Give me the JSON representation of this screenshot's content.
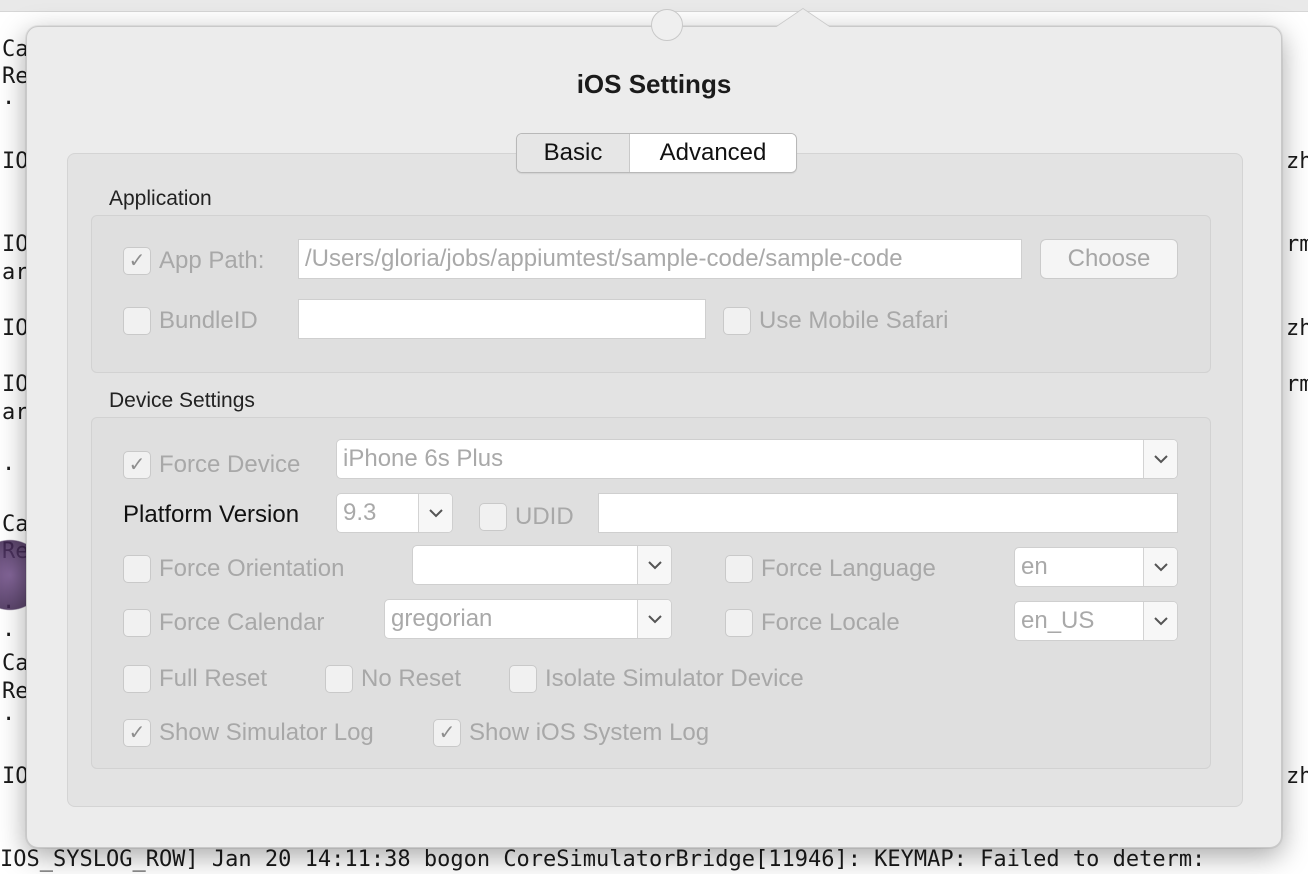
{
  "terminal": {
    "left_lines": [
      {
        "text": "Ca",
        "row": 50
      },
      {
        "text": "Re",
        "row": 77
      },
      {
        "text": "· G",
        "row": 104
      },
      {
        "text": "IO",
        "row": 162
      },
      {
        "text": "IO",
        "row": 245
      },
      {
        "text": "aro",
        "row": 273
      },
      {
        "text": "IO",
        "row": 329
      },
      {
        "text": "IO",
        "row": 385
      },
      {
        "text": "aro",
        "row": 413
      },
      {
        "text": "· G",
        "row": 470
      },
      {
        "text": "Ca",
        "row": 525
      },
      {
        "text": "Re",
        "row": 552
      },
      {
        "text": "· G",
        "row": 608
      },
      {
        "text": "· G",
        "row": 636
      },
      {
        "text": "Ca",
        "row": 664
      },
      {
        "text": "Re",
        "row": 692
      },
      {
        "text": "· G",
        "row": 720
      },
      {
        "text": "IO",
        "row": 777
      }
    ],
    "right_lines": [
      {
        "text": "zh",
        "row": 162
      },
      {
        "text": "rm:",
        "row": 245
      },
      {
        "text": "zh",
        "row": 329
      },
      {
        "text": "rm:",
        "row": 385
      },
      {
        "text": "zh",
        "row": 777
      }
    ],
    "bottom_line": "IOS_SYSLOG_ROW] Jan 20 14:11:38 bogon CoreSimulatorBridge[11946]: KEYMAP: Failed to determ:"
  },
  "dialog": {
    "title": "iOS Settings",
    "tabs": [
      {
        "label": "Basic",
        "selected": false
      },
      {
        "label": "Advanced",
        "selected": true
      }
    ]
  },
  "application": {
    "section_label": "Application",
    "app_path": {
      "label": "App Path:",
      "checked": true,
      "value": "/Users/gloria/jobs/appiumtest/sample-code/sample-code"
    },
    "choose_button": "Choose",
    "bundle_id": {
      "label": "BundleID",
      "checked": false,
      "value": ""
    },
    "use_mobile_safari": {
      "label": "Use Mobile Safari",
      "checked": false
    }
  },
  "device_settings": {
    "section_label": "Device Settings",
    "force_device": {
      "label": "Force Device",
      "checked": true,
      "value": "iPhone 6s Plus"
    },
    "platform_version": {
      "label": "Platform Version",
      "value": "9.3"
    },
    "udid": {
      "label": "UDID",
      "checked": false,
      "value": ""
    },
    "force_orientation": {
      "label": "Force Orientation",
      "checked": false,
      "value": ""
    },
    "force_language": {
      "label": "Force Language",
      "checked": false,
      "value": "en"
    },
    "force_calendar": {
      "label": "Force Calendar",
      "checked": false,
      "value": "gregorian"
    },
    "force_locale": {
      "label": "Force Locale",
      "checked": false,
      "value": "en_US"
    },
    "full_reset": {
      "label": "Full Reset",
      "checked": false
    },
    "no_reset": {
      "label": "No Reset",
      "checked": false
    },
    "isolate_simulator": {
      "label": "Isolate Simulator Device",
      "checked": false
    },
    "show_simulator_log": {
      "label": "Show Simulator Log",
      "checked": true
    },
    "show_ios_system_log": {
      "label": "Show iOS System Log",
      "checked": true
    }
  },
  "colors": {
    "popover_bg": "#ececec",
    "disabled_text": "#a8a8a8",
    "section_box": "#dfdfdf"
  }
}
